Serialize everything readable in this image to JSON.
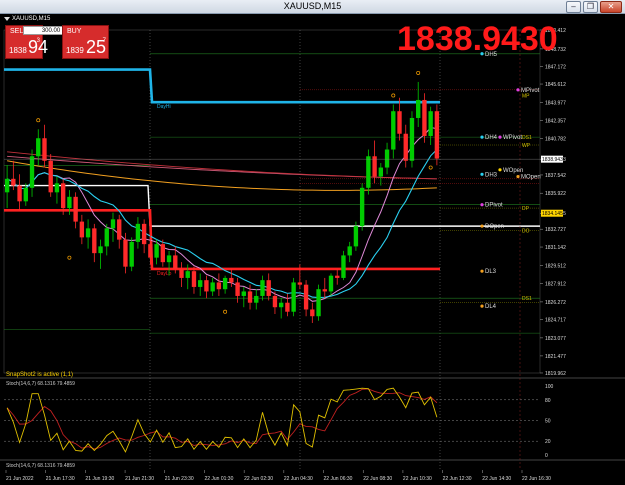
{
  "window": {
    "title": "XAUUSD,M15"
  },
  "symbol_label": "XAUUSD,M15",
  "trade_panel": {
    "sell_label": "SELL",
    "buy_label": "BUY",
    "lot_value": "300.00",
    "sell_prefix": "1838",
    "sell_big": "94",
    "sell_sup": "3",
    "buy_prefix": "1839",
    "buy_big": "25",
    "buy_sup": "7"
  },
  "big_price": "1838.9430",
  "snapshot_text": "SnapShot2 is active (1,1)",
  "oscillator_label": "Stoch(14,6,7) 68.1316 79.4859",
  "oscillator_label2": "Stoch(14,6,7) 68.1316 79.4859",
  "colors": {
    "bull": "#00cc00",
    "bear": "#ff2a2a",
    "dayhi": "#1fb4e8",
    "daylo": "#ff2020",
    "ma_cyan": "#2ad0f0",
    "ma_pink": "#e08ad8",
    "ma_orange": "#f2a020",
    "ma_red": "#c0303a",
    "white_line": "#ffffff",
    "dashed": "#a0a0a0"
  },
  "chart_data": {
    "type": "candlestick",
    "price_axis": [
      "1850.412",
      "1848.732",
      "1847.172",
      "1845.612",
      "1843.977",
      "1842.357",
      "1840.782",
      "1838.943",
      "1837.542",
      "1835.922",
      "1834.145",
      "1832.727",
      "1831.142",
      "1829.512",
      "1827.912",
      "1826.272",
      "1824.717",
      "1823.077",
      "1821.477",
      "1819.962"
    ],
    "ylim": [
      1819.96,
      1850.41
    ],
    "price_tags": [
      {
        "label": "1838.943",
        "value": 1838.943,
        "color": "#ffffff",
        "text": "#000000"
      },
      {
        "label": "1834.145",
        "value": 1834.145,
        "color": "#ffd400",
        "text": "#000000"
      }
    ],
    "time_axis": [
      "21 Jun 2022",
      "21 Jun 17:30",
      "21 Jun 19:30",
      "21 Jun 21:30",
      "21 Jun 23:30",
      "22 Jun 01:30",
      "22 Jun 02:30",
      "22 Jun 04:30",
      "22 Jun 06:30",
      "22 Jun 08:30",
      "22 Jun 10:30",
      "22 Jun 12:30",
      "22 Jun 14:30",
      "22 Jun 16:30"
    ],
    "levels": [
      {
        "name": "DayHi",
        "value": 1844.0
      },
      {
        "name": "DayLo",
        "value": 1829.2
      },
      {
        "name": "DH5",
        "value": 1848.3
      },
      {
        "name": "DH4",
        "value": 1840.9
      },
      {
        "name": "DH3",
        "value": 1837.6
      },
      {
        "name": "DPivot",
        "value": 1834.9
      },
      {
        "name": "DOpen",
        "value": 1833.0
      },
      {
        "name": "DL3",
        "value": 1829.0
      },
      {
        "name": "DL4",
        "value": 1825.9
      },
      {
        "name": "MPivot",
        "value": 1845.1
      },
      {
        "name": "MP",
        "value": 1844.6
      },
      {
        "name": "WPivot",
        "value": 1840.7
      },
      {
        "name": "WP",
        "value": 1840.2
      },
      {
        "name": "DS1",
        "value": 1840.9
      },
      {
        "name": "WOpen",
        "value": 1838.0
      },
      {
        "name": "MOpen",
        "value": 1837.4
      },
      {
        "name": "DP",
        "value": 1834.6
      },
      {
        "name": "DO",
        "value": 1832.6
      },
      {
        "name": "DS1",
        "value": 1826.6
      }
    ],
    "candles": [
      [
        1836.0,
        1838.4,
        1834.6,
        1837.2
      ],
      [
        1837.2,
        1838.8,
        1836.2,
        1836.6
      ],
      [
        1836.6,
        1837.6,
        1834.4,
        1835.2
      ],
      [
        1835.2,
        1836.8,
        1834.8,
        1836.4
      ],
      [
        1836.4,
        1839.8,
        1835.6,
        1839.2
      ],
      [
        1839.2,
        1841.6,
        1838.4,
        1840.8
      ],
      [
        1840.8,
        1842.0,
        1838.2,
        1838.8
      ],
      [
        1838.8,
        1839.4,
        1835.6,
        1836.0
      ],
      [
        1836.0,
        1837.4,
        1835.0,
        1836.8
      ],
      [
        1836.8,
        1837.2,
        1834.0,
        1834.6
      ],
      [
        1834.6,
        1836.2,
        1834.0,
        1835.6
      ],
      [
        1835.6,
        1836.0,
        1832.8,
        1833.4
      ],
      [
        1833.4,
        1834.0,
        1831.4,
        1832.0
      ],
      [
        1832.0,
        1833.6,
        1831.0,
        1832.8
      ],
      [
        1832.8,
        1833.2,
        1829.8,
        1830.6
      ],
      [
        1830.6,
        1831.8,
        1829.2,
        1831.2
      ],
      [
        1831.2,
        1833.2,
        1830.4,
        1832.8
      ],
      [
        1832.8,
        1834.2,
        1831.6,
        1833.6
      ],
      [
        1833.6,
        1834.0,
        1831.0,
        1831.8
      ],
      [
        1831.8,
        1832.4,
        1828.8,
        1829.4
      ],
      [
        1829.4,
        1832.0,
        1829.0,
        1831.6
      ],
      [
        1831.6,
        1833.8,
        1831.0,
        1833.2
      ],
      [
        1833.2,
        1833.6,
        1830.6,
        1831.4
      ],
      [
        1831.4,
        1832.2,
        1829.6,
        1830.2
      ],
      [
        1830.2,
        1831.8,
        1829.6,
        1831.4
      ],
      [
        1831.4,
        1831.8,
        1829.4,
        1829.8
      ],
      [
        1829.8,
        1830.8,
        1828.6,
        1830.4
      ],
      [
        1830.4,
        1831.2,
        1828.8,
        1829.2
      ],
      [
        1829.2,
        1829.8,
        1827.6,
        1828.4
      ],
      [
        1828.4,
        1829.6,
        1827.4,
        1829.0
      ],
      [
        1829.0,
        1829.4,
        1827.0,
        1827.6
      ],
      [
        1827.6,
        1828.8,
        1826.8,
        1828.2
      ],
      [
        1828.2,
        1828.6,
        1826.6,
        1827.2
      ],
      [
        1827.2,
        1828.4,
        1826.8,
        1828.0
      ],
      [
        1828.0,
        1828.8,
        1826.8,
        1827.4
      ],
      [
        1827.4,
        1828.6,
        1827.0,
        1828.4
      ],
      [
        1828.4,
        1829.2,
        1827.6,
        1828.0
      ],
      [
        1828.0,
        1828.4,
        1826.2,
        1826.8
      ],
      [
        1826.8,
        1827.6,
        1825.8,
        1827.2
      ],
      [
        1827.2,
        1827.8,
        1825.6,
        1826.2
      ],
      [
        1826.2,
        1827.4,
        1825.6,
        1826.8
      ],
      [
        1826.8,
        1828.6,
        1826.4,
        1828.2
      ],
      [
        1828.2,
        1828.8,
        1826.4,
        1826.8
      ],
      [
        1826.8,
        1827.2,
        1825.2,
        1825.8
      ],
      [
        1825.8,
        1826.6,
        1824.8,
        1826.2
      ],
      [
        1826.2,
        1827.0,
        1825.0,
        1825.4
      ],
      [
        1825.4,
        1828.4,
        1825.0,
        1828.0
      ],
      [
        1828.0,
        1829.6,
        1827.4,
        1827.8
      ],
      [
        1827.8,
        1828.2,
        1825.0,
        1825.6
      ],
      [
        1825.6,
        1826.2,
        1824.4,
        1825.0
      ],
      [
        1825.0,
        1827.8,
        1824.6,
        1827.4
      ],
      [
        1827.4,
        1828.4,
        1826.6,
        1827.2
      ],
      [
        1827.2,
        1828.8,
        1826.8,
        1828.6
      ],
      [
        1828.6,
        1829.2,
        1827.8,
        1828.4
      ],
      [
        1828.4,
        1830.8,
        1828.2,
        1830.4
      ],
      [
        1830.4,
        1831.6,
        1829.8,
        1831.2
      ],
      [
        1831.2,
        1833.4,
        1830.8,
        1833.0
      ],
      [
        1833.0,
        1836.8,
        1832.6,
        1836.4
      ],
      [
        1836.4,
        1839.8,
        1835.8,
        1839.2
      ],
      [
        1839.2,
        1840.6,
        1836.8,
        1837.4
      ],
      [
        1837.4,
        1838.6,
        1836.6,
        1838.2
      ],
      [
        1838.2,
        1840.4,
        1837.6,
        1839.8
      ],
      [
        1839.8,
        1843.8,
        1839.0,
        1843.2
      ],
      [
        1843.2,
        1844.4,
        1840.6,
        1841.2
      ],
      [
        1841.2,
        1842.0,
        1838.2,
        1838.8
      ],
      [
        1838.8,
        1843.2,
        1838.2,
        1842.6
      ],
      [
        1842.6,
        1845.8,
        1841.8,
        1844.2
      ],
      [
        1844.2,
        1844.8,
        1840.4,
        1841.0
      ],
      [
        1841.0,
        1843.6,
        1840.2,
        1843.2
      ],
      [
        1843.2,
        1843.8,
        1838.4,
        1839.0
      ]
    ]
  }
}
